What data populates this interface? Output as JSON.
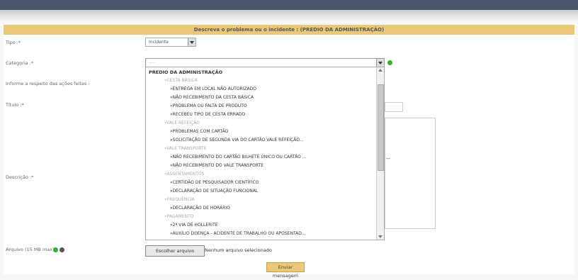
{
  "header": {
    "title": "Descreva o problema ou o incidente : (PREDIO DA ADMINISTRAÇÃO)"
  },
  "labels": {
    "tipo": "Tipo :*",
    "categoria": "Categoria :*",
    "informe": "Informe a respeito das ações feitas :",
    "titulo": "Título :*",
    "descricao": "Descrição :*",
    "arquivo": "Arquivo (15 MB max)"
  },
  "tipo": {
    "value": "Incidente"
  },
  "categoria": {
    "value": "----"
  },
  "dropdown": {
    "options": [
      {
        "level": "top",
        "text": "PREDIO DA ADMINISTRAÇÃO"
      },
      {
        "level": "grp",
        "text": "»CESTA BÁSICA"
      },
      {
        "level": "item",
        "text": "»ENTREGA EM LOCAL NÃO AUTORIZADO"
      },
      {
        "level": "item",
        "text": "»NÃO RECEBIMENTO DA CESTA BÁSICA"
      },
      {
        "level": "item",
        "text": "»PROBLEMA OU FALTA DE PRODUTO"
      },
      {
        "level": "item",
        "text": "»RECEBEU TIPO DE CESTA ERRADO"
      },
      {
        "level": "grp",
        "text": "»VALE REFEIÇÃO"
      },
      {
        "level": "item",
        "text": "»PROBLEMAS COM CARTÃO"
      },
      {
        "level": "item",
        "text": "»SOLICITAÇÃO DE SEGUNDA VIA DO CARTÃO VALE REFEIÇÃO..."
      },
      {
        "level": "grp",
        "text": "»VALE TRANSPORTE"
      },
      {
        "level": "item",
        "text": "»NÃO RECEBIMENTO DO CARTÃO BILHETE ÚNICO OU CARTÃO ..."
      },
      {
        "level": "item",
        "text": "»NÃO RECEBIMENTO DO VALE TRANSPORTE"
      },
      {
        "level": "grp",
        "text": "»ASSENTAMENTOS"
      },
      {
        "level": "item",
        "text": "»CERTIDÃO DE PESQUISADOR CIENTÍFICO"
      },
      {
        "level": "item",
        "text": "»DECLARAÇÃO DE SITUAÇÃO FUNCIONAL"
      },
      {
        "level": "grp",
        "text": "»FREQUÊNCIA"
      },
      {
        "level": "item",
        "text": "»DECLARAÇÃO DE HORÁRIO"
      },
      {
        "level": "grp",
        "text": "»PAGAMENTO"
      },
      {
        "level": "item",
        "text": "»2ª VIA DE HOLLERITE"
      },
      {
        "level": "item",
        "text": "»AUXÍLIO DOENÇA - ACIDENTE DE TRABALHO OU APOSENTAD..."
      }
    ]
  },
  "dashes": "--",
  "arquivo": {
    "button": "Escolher arquivo",
    "status": "Nenhum arquivo selecionado"
  },
  "send_button": "Enviar mensagem",
  "icons": [
    "green-dot-icon",
    "dark-dot-icon",
    "chevron-down-icon"
  ],
  "colors": {
    "header_bg": "#e9c87a",
    "topbar": "#4a5768",
    "status_green": "#34b233"
  }
}
